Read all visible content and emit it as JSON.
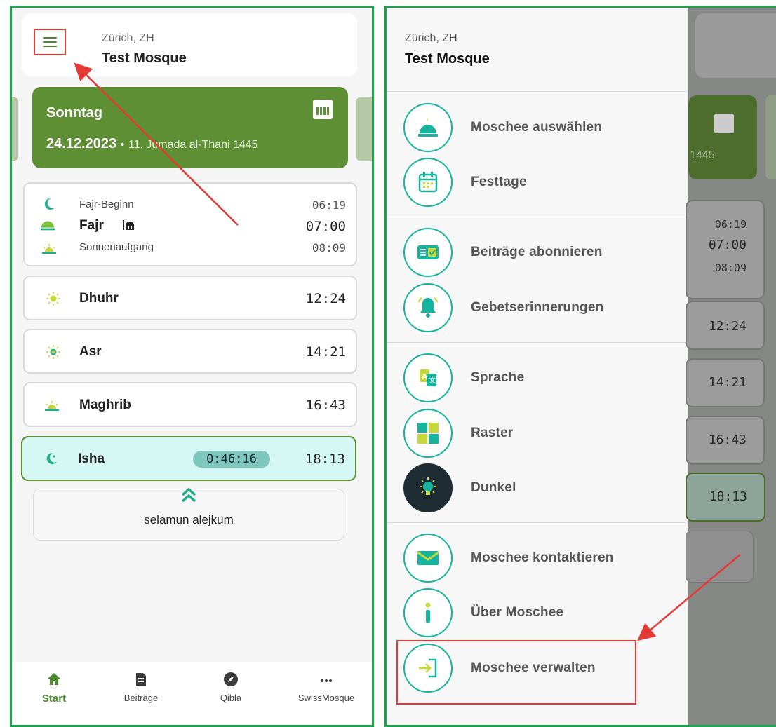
{
  "colors": {
    "brand_green": "#5e8f34",
    "accent_teal": "#17b39c",
    "highlight_red": "#e53935",
    "frame_green": "#1aa34a",
    "isha_bg": "#d6f8f5"
  },
  "home": {
    "header": {
      "city": "Zürich, ZH",
      "mosque": "Test Mosque",
      "menu_icon": "hamburger-menu-icon"
    },
    "day_card": {
      "weekday": "Sonntag",
      "date": "24.12.2023",
      "separator": "•",
      "hijri": "11. Jumada al-Thani 1445",
      "icon": "calendar-icon"
    },
    "fajr_group": {
      "begin_label": "Fajr-Beginn",
      "begin_time": "06:19",
      "name": "Fajr",
      "time": "07:00",
      "sunrise_label": "Sonnenaufgang",
      "sunrise_time": "08:09"
    },
    "prayers": [
      {
        "name": "Dhuhr",
        "time": "12:24",
        "icon": "sun-icon"
      },
      {
        "name": "Asr",
        "time": "14:21",
        "icon": "sun-icon"
      },
      {
        "name": "Maghrib",
        "time": "16:43",
        "icon": "sunset-icon"
      }
    ],
    "isha": {
      "name": "Isha",
      "countdown": "0:46:16",
      "time": "18:13",
      "icon": "crescent-icon"
    },
    "greeting": "selamun alejkum",
    "nav": [
      {
        "label": "Start",
        "icon": "home-icon",
        "active": true
      },
      {
        "label": "Beiträge",
        "icon": "article-icon",
        "active": false
      },
      {
        "label": "Qibla",
        "icon": "compass-icon",
        "active": false
      },
      {
        "label": "SwissMosque",
        "icon": "more-dots-icon",
        "active": false
      }
    ]
  },
  "drawer": {
    "city": "Zürich, ZH",
    "mosque": "Test Mosque",
    "items": [
      {
        "label": "Moschee auswählen",
        "icon": "mosque-dome-icon"
      },
      {
        "label": "Festtage",
        "icon": "calendar-icon"
      },
      {
        "label": "Beiträge abonnieren",
        "icon": "subscribe-card-icon"
      },
      {
        "label": "Gebetserinnerungen",
        "icon": "bell-icon"
      },
      {
        "label": "Sprache",
        "icon": "language-icon"
      },
      {
        "label": "Raster",
        "icon": "grid-icon"
      },
      {
        "label": "Dunkel",
        "icon": "lightbulb-icon"
      },
      {
        "label": "Moschee kontaktieren",
        "icon": "envelope-icon"
      },
      {
        "label": "Über Moschee",
        "icon": "info-icon"
      },
      {
        "label": "Moschee verwalten",
        "icon": "login-icon"
      }
    ],
    "background_times": {
      "fajr_begin": "06:19",
      "fajr": "07:00",
      "sunrise": "08:09",
      "dhuhr": "12:24",
      "asr": "14:21",
      "maghrib": "16:43",
      "isha": "18:13",
      "hijri_year": "1445"
    }
  }
}
